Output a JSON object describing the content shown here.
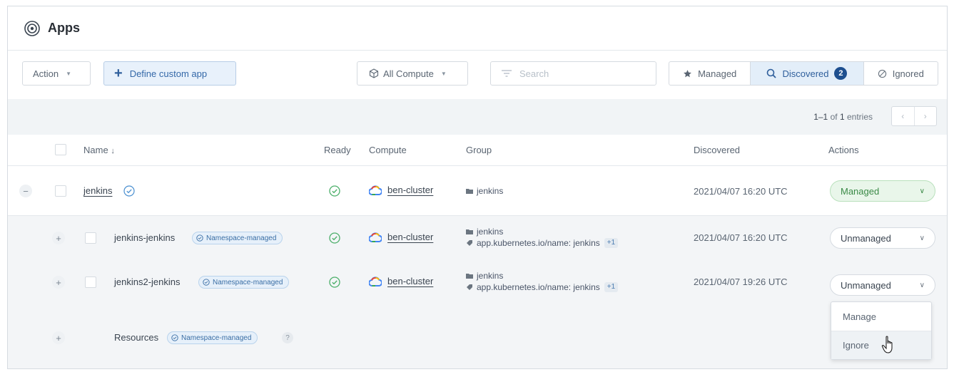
{
  "header": {
    "title": "Apps"
  },
  "toolbar": {
    "action_label": "Action",
    "define_label": "Define custom app",
    "compute_label": "All Compute",
    "search_placeholder": "Search",
    "segments": {
      "managed": "Managed",
      "discovered": "Discovered",
      "discovered_count": "2",
      "ignored": "Ignored"
    }
  },
  "pagination": {
    "range": "1–1",
    "of": "of",
    "total": "1",
    "suffix": "entries"
  },
  "table": {
    "headers": {
      "name": "Name",
      "ready": "Ready",
      "compute": "Compute",
      "group": "Group",
      "discovered": "Discovered",
      "actions": "Actions"
    },
    "rows": [
      {
        "name": "jenkins",
        "compute": "ben-cluster",
        "group": "jenkins",
        "label": "",
        "label_extra": "",
        "discovered": "2021/04/07 16:20 UTC",
        "action": "Managed",
        "badge": ""
      },
      {
        "name": "jenkins-jenkins",
        "compute": "ben-cluster",
        "group": "jenkins",
        "label": "app.kubernetes.io/name: jenkins",
        "label_extra": "+1",
        "discovered": "2021/04/07 16:20 UTC",
        "action": "Unmanaged",
        "badge": "Namespace-managed"
      },
      {
        "name": "jenkins2-jenkins",
        "compute": "ben-cluster",
        "group": "jenkins",
        "label": "app.kubernetes.io/name: jenkins",
        "label_extra": "+1",
        "discovered": "2021/04/07 19:26 UTC",
        "action": "Unmanaged",
        "badge": "Namespace-managed"
      },
      {
        "name": "Resources",
        "badge": "Namespace-managed",
        "help": "?"
      }
    ]
  },
  "dropdown_menu": {
    "items": [
      "Manage",
      "Ignore"
    ]
  },
  "colors": {
    "accent": "#1e4f8f",
    "managed_green": "#3b8a47",
    "ready_green": "#4caf6a",
    "badge_blue": "#3a6ea5"
  }
}
